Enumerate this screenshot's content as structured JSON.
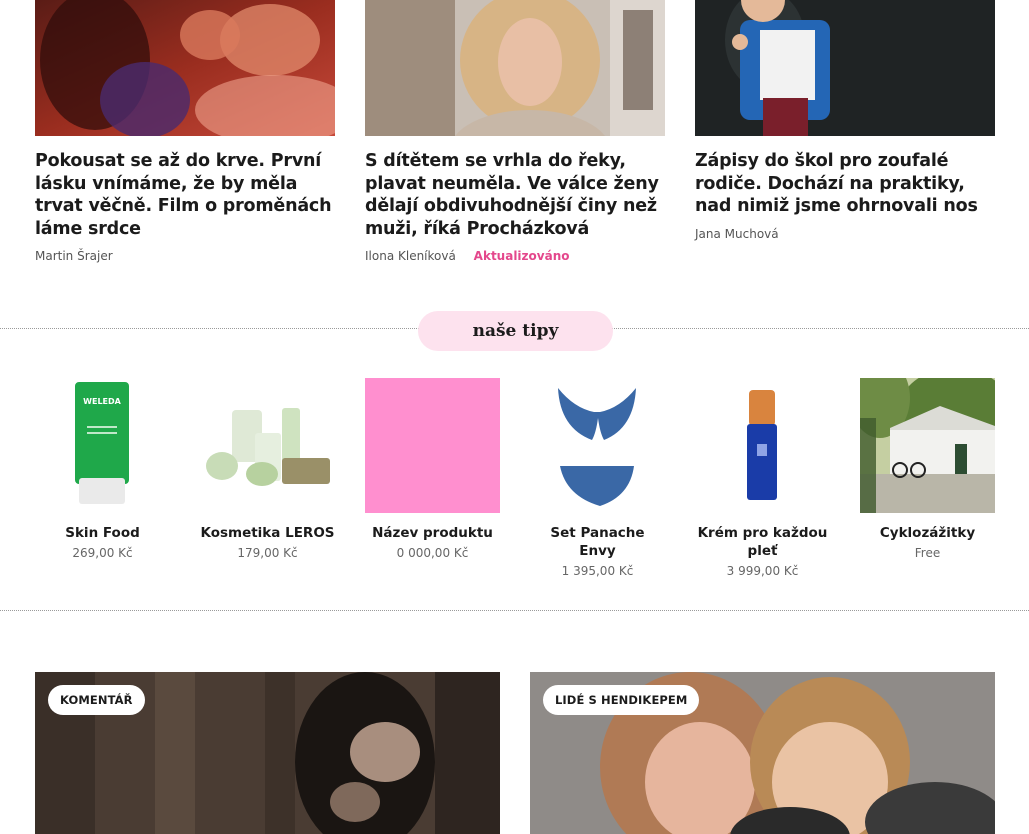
{
  "articles": [
    {
      "title": "Pokousat se až do krve. První lásku vnímáme, že by měla trvat věčně. Film o proměnách láme srdce",
      "author": "Martin Šrajer",
      "updated": ""
    },
    {
      "title": "S dítětem se vrhla do řeky, plavat neuměla. Ve válce ženy dělají obdivuhodnější činy než muži, říká Procházková",
      "author": "Ilona Kleníková",
      "updated": "Aktualizováno"
    },
    {
      "title": "Zápisy do škol pro zoufalé rodiče. Dochází na praktiky, nad nimiž jsme ohrnovali nos",
      "author": "Jana Muchová",
      "updated": ""
    }
  ],
  "tips": {
    "heading": "naše tipy",
    "products": [
      {
        "name": "Skin Food",
        "price": "269,00 Kč"
      },
      {
        "name": "Kosmetika LEROS",
        "price": "179,00 Kč"
      },
      {
        "name": "Název produktu",
        "price": "0 000,00 Kč"
      },
      {
        "name": "Set Panache Envy",
        "price": "1 395,00 Kč"
      },
      {
        "name": "Krém pro každou pleť",
        "price": "3 999,00 Kč"
      },
      {
        "name": "Cyklozážitky",
        "price": "Free"
      }
    ]
  },
  "cards": [
    {
      "badge": "KOMENTÁŘ"
    },
    {
      "badge": "LIDÉ S HENDIKEPEM"
    }
  ],
  "colors": {
    "accent": "#e4478c",
    "pill": "#fde2ee",
    "placeholder": "#ff8fcf"
  }
}
